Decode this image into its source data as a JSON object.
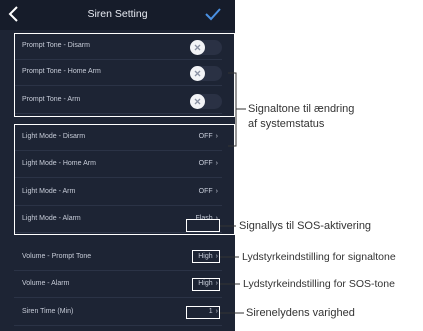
{
  "header": {
    "title": "Siren Setting",
    "back_icon": "chevron-left-icon",
    "confirm_icon": "checkmark-icon"
  },
  "colors": {
    "background": "#1d2434",
    "header": "#161c2a",
    "accent": "#4a90e2",
    "text": "#c7ccd8"
  },
  "rows": {
    "prompt_disarm": {
      "label": "Prompt Tone - Disarm",
      "toggle_on": false
    },
    "prompt_home_arm": {
      "label": "Prompt Tone - Home Arm",
      "toggle_on": false
    },
    "prompt_arm": {
      "label": "Prompt Tone - Arm",
      "toggle_on": false
    },
    "light_disarm": {
      "label": "Light Mode - Disarm",
      "value": "OFF"
    },
    "light_home_arm": {
      "label": "Light Mode - Home Arm",
      "value": "OFF"
    },
    "light_arm": {
      "label": "Light Mode - Arm",
      "value": "OFF"
    },
    "light_alarm": {
      "label": "Light Mode - Alarm",
      "value": "Flash"
    },
    "volume_prompt": {
      "label": "Volume - Prompt Tone",
      "value": "High"
    },
    "volume_alarm": {
      "label": "Volume - Alarm",
      "value": "High"
    },
    "siren_time": {
      "label": "Siren Time (Min)",
      "value": "1"
    }
  },
  "annotations": {
    "status_tone_line1": "Signaltone til ændring",
    "status_tone_line2": "af systemstatus",
    "sos_light": "Signallys til SOS-aktivering",
    "volume_tone": "Lydstyrkeindstilling for signaltone",
    "volume_sos": "Lydstyrkeindstilling for SOS-tone",
    "siren_duration": "Sirenelydens varighed"
  }
}
